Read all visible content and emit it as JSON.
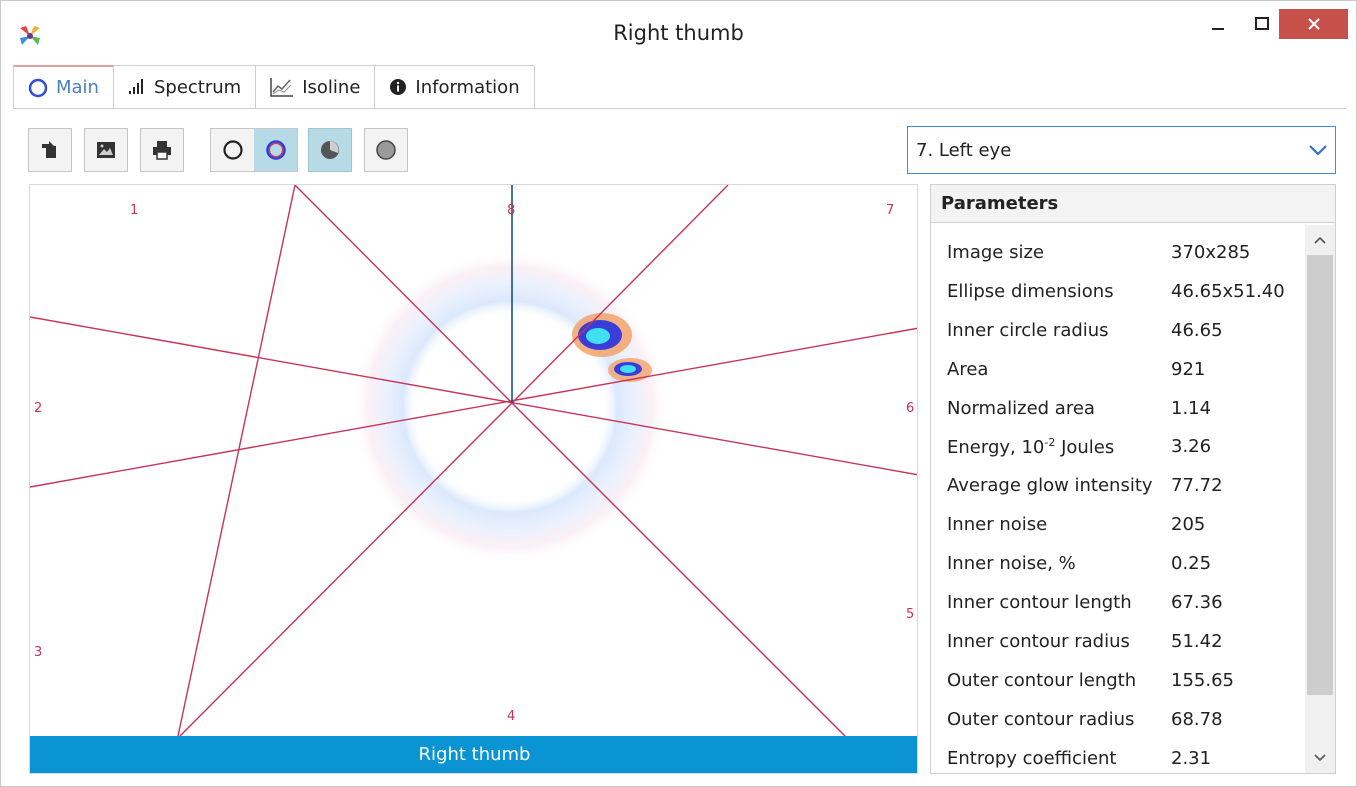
{
  "window": {
    "title": "Right thumb",
    "colors": {
      "close": "#c7504a",
      "accent": "#0b94d4",
      "lines": "#c83358",
      "vertical": "#1a4f8a"
    }
  },
  "tabs": [
    {
      "label": "Main",
      "icon": "circle-outline-icon",
      "active": true
    },
    {
      "label": "Spectrum",
      "icon": "bar-chart-icon",
      "active": false
    },
    {
      "label": "Isoline",
      "icon": "line-chart-icon",
      "active": false
    },
    {
      "label": "Information",
      "icon": "info-circle-icon",
      "active": false
    }
  ],
  "toolbar": {
    "buttons": [
      "export-icon",
      "image-icon",
      "print-icon",
      "circle-black-icon",
      "circle-blue-red-icon",
      "pie-icon",
      "filled-circle-icon"
    ],
    "selected_segment": "circle-blue-red-icon",
    "selected_button": "pie-icon"
  },
  "dropdown": {
    "selected": "7. Left eye"
  },
  "canvas": {
    "label": "Right thumb",
    "sectors": [
      "1",
      "2",
      "3",
      "4",
      "5",
      "6",
      "7",
      "8"
    ]
  },
  "parameters": {
    "header": "Parameters",
    "rows": [
      {
        "label": "Image size",
        "value": "370x285"
      },
      {
        "label": "Ellipse dimensions",
        "value": "46.65x51.40"
      },
      {
        "label": "Inner circle radius",
        "value": "46.65"
      },
      {
        "label": "Area",
        "value": "921"
      },
      {
        "label": "Normalized area",
        "value": "1.14"
      },
      {
        "label_pre": "Energy, 10",
        "label_sup": "-2",
        "label_post": " Joules",
        "value": "3.26"
      },
      {
        "label": "Average glow intensity",
        "value": "77.72"
      },
      {
        "label": "Inner noise",
        "value": "205"
      },
      {
        "label": "Inner noise, %",
        "value": "0.25"
      },
      {
        "label": "Inner contour length",
        "value": "67.36"
      },
      {
        "label": "Inner contour radius",
        "value": "51.42"
      },
      {
        "label": "Outer contour length",
        "value": "155.65"
      },
      {
        "label": "Outer contour radius",
        "value": "68.78"
      },
      {
        "label": "Entropy coefficient",
        "value": "2.31"
      }
    ]
  }
}
